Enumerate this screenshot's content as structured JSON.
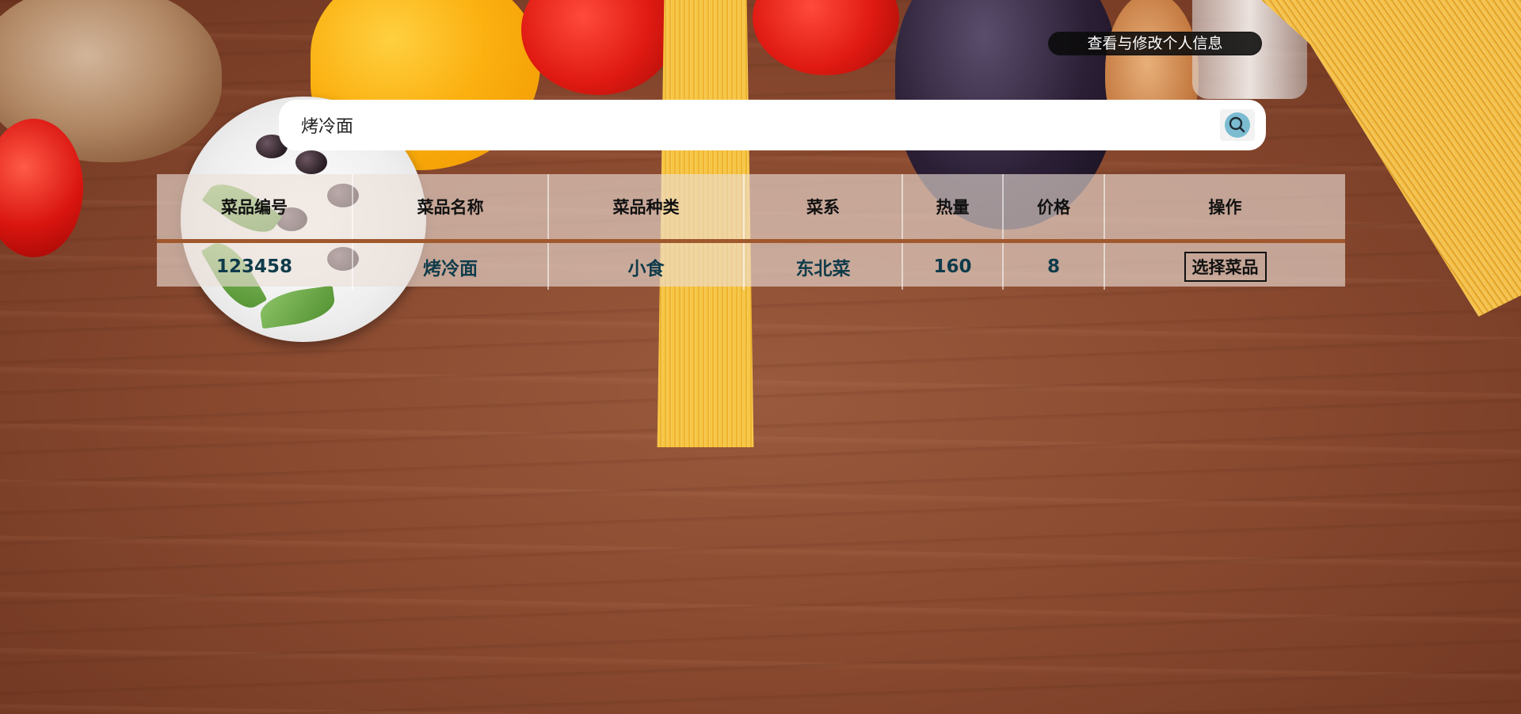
{
  "header": {
    "profile_button_label": "查看与修改个人信息"
  },
  "search": {
    "value": "烤冷面",
    "icon": "search-icon",
    "icon_color": "#7bbcd1"
  },
  "table": {
    "columns": [
      "菜品编号",
      "菜品名称",
      "菜品种类",
      "菜系",
      "热量",
      "价格",
      "操作"
    ],
    "rows": [
      {
        "id": "123458",
        "name": "烤冷面",
        "category": "小食",
        "cuisine": "东北菜",
        "calories": "160",
        "price": "8",
        "action_label": "选择菜品"
      }
    ]
  },
  "colors": {
    "header_divider": "#a0582c",
    "cell_text": "#0f3b4a"
  }
}
